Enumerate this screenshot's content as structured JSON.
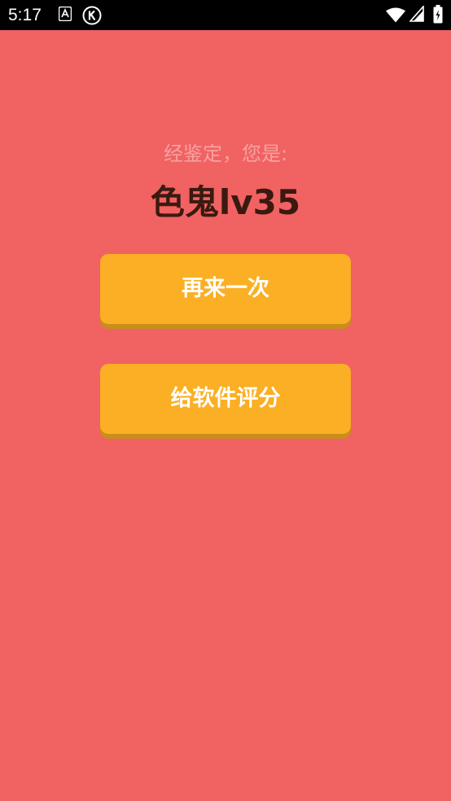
{
  "status_bar": {
    "time": "5:17",
    "icons": [
      "text-notification-icon",
      "k-notification-icon",
      "wifi-icon",
      "cell-signal-icon",
      "battery-icon"
    ]
  },
  "main": {
    "subtitle": "经鉴定，您是:",
    "result": "色鬼lv35"
  },
  "buttons": {
    "retry_label": "再来一次",
    "rate_label": "给软件评分"
  },
  "colors": {
    "background": "#f16262",
    "button": "#fbaf25",
    "button_shadow": "#c98e1b",
    "result_text": "#3a1a10",
    "subtitle_text": "#f7a2a2"
  }
}
